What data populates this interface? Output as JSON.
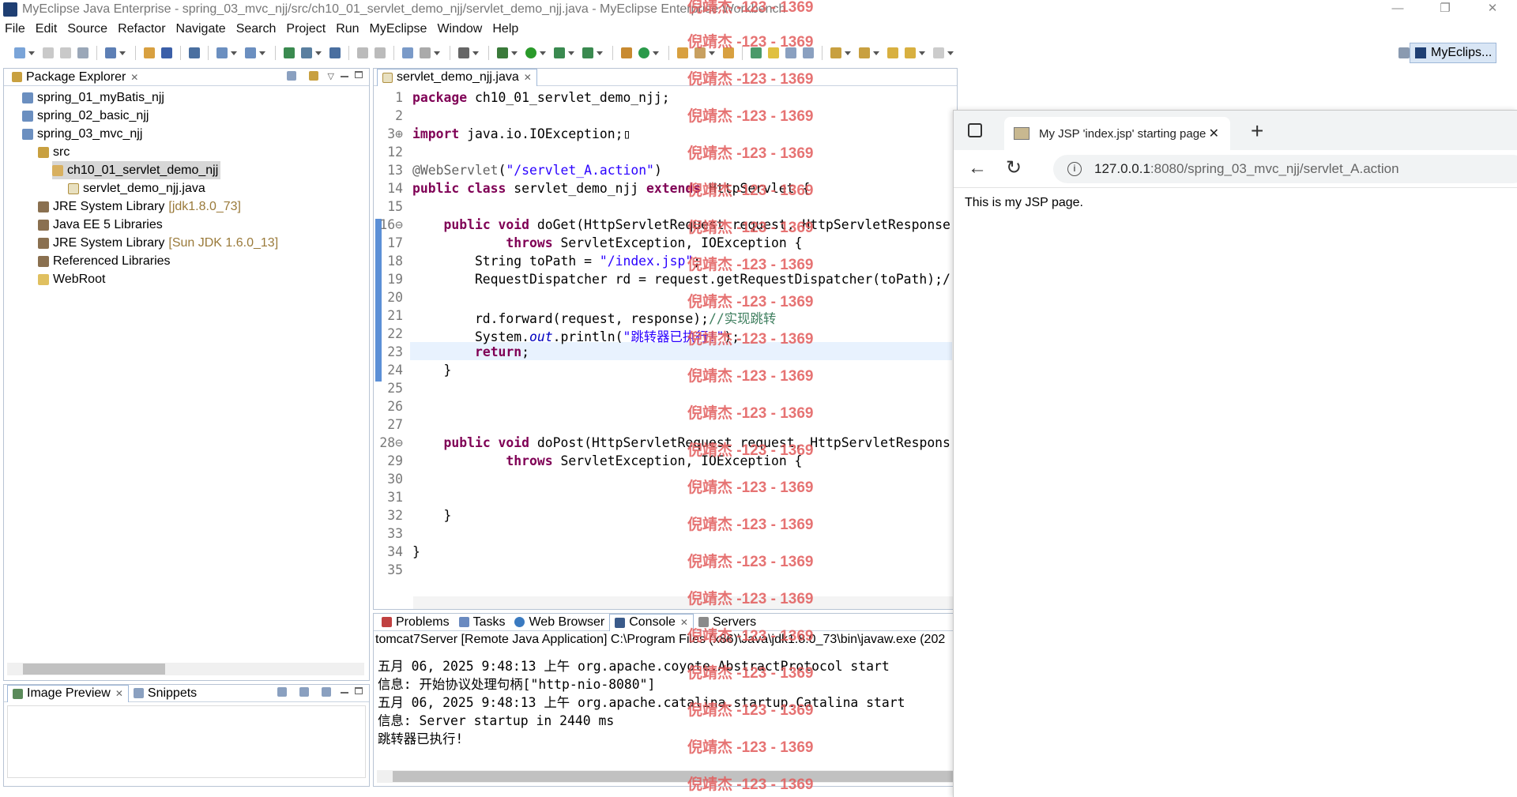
{
  "window": {
    "title": "MyEclipse Java Enterprise - spring_03_mvc_njj/src/ch10_01_servlet_demo_njj/servlet_demo_njj.java - MyEclipse Enterprise Workbench",
    "minimize": "—",
    "restore": "❐",
    "close": "✕"
  },
  "menu": [
    "File",
    "Edit",
    "Source",
    "Refactor",
    "Navigate",
    "Search",
    "Project",
    "Run",
    "MyEclipse",
    "Window",
    "Help"
  ],
  "perspective": "MyEclips...",
  "package_explorer": {
    "tab": "Package Explorer",
    "items": [
      {
        "label": "spring_01_myBatis_njj",
        "extra": ""
      },
      {
        "label": "spring_02_basic_njj",
        "extra": ""
      },
      {
        "label": "spring_03_mvc_njj",
        "extra": ""
      },
      {
        "label": "src",
        "extra": ""
      },
      {
        "label": "ch10_01_servlet_demo_njj",
        "extra": ""
      },
      {
        "label": "servlet_demo_njj.java",
        "extra": ""
      },
      {
        "label": "JRE System Library",
        "extra": "[jdk1.8.0_73]"
      },
      {
        "label": "Java EE 5 Libraries",
        "extra": ""
      },
      {
        "label": "JRE System Library",
        "extra": "[Sun JDK 1.6.0_13]"
      },
      {
        "label": "Referenced Libraries",
        "extra": ""
      },
      {
        "label": "WebRoot",
        "extra": ""
      }
    ]
  },
  "image_preview": {
    "tab": "Image Preview",
    "tab2": "Snippets"
  },
  "editor": {
    "tab": "servlet_demo_njj.java",
    "lines": [
      {
        "n": "1",
        "code": "package ch10_01_servlet_demo_njj;"
      },
      {
        "n": "2",
        "code": ""
      },
      {
        "n": "3⊕",
        "code": "import java.io.IOException;▯"
      },
      {
        "n": "12",
        "code": ""
      },
      {
        "n": "13",
        "code": "@WebServlet(\"/servlet_A.action\")"
      },
      {
        "n": "14",
        "code": "public class servlet_demo_njj extends HttpServlet {"
      },
      {
        "n": "15",
        "code": ""
      },
      {
        "n": "16⊖",
        "code": "    public void doGet(HttpServletRequest request, HttpServletResponse"
      },
      {
        "n": "17",
        "code": "            throws ServletException, IOException {"
      },
      {
        "n": "18",
        "code": "        String toPath = \"/index.jsp\";"
      },
      {
        "n": "19",
        "code": "        RequestDispatcher rd = request.getRequestDispatcher(toPath);/"
      },
      {
        "n": "20",
        "code": ""
      },
      {
        "n": "21",
        "code": "        rd.forward(request, response);//实现跳转"
      },
      {
        "n": "22",
        "code": "        System.out.println(\"跳转器已执行!\");"
      },
      {
        "n": "23",
        "code": "        return;"
      },
      {
        "n": "24",
        "code": "    }"
      },
      {
        "n": "25",
        "code": ""
      },
      {
        "n": "26",
        "code": ""
      },
      {
        "n": "27",
        "code": ""
      },
      {
        "n": "28⊖",
        "code": "    public void doPost(HttpServletRequest request, HttpServletRespons"
      },
      {
        "n": "29",
        "code": "            throws ServletException, IOException {"
      },
      {
        "n": "30",
        "code": ""
      },
      {
        "n": "31",
        "code": ""
      },
      {
        "n": "32",
        "code": "    }"
      },
      {
        "n": "33",
        "code": ""
      },
      {
        "n": "34",
        "code": "}"
      },
      {
        "n": "35",
        "code": ""
      }
    ]
  },
  "bottom": {
    "tabs": [
      "Problems",
      "Tasks",
      "Web Browser",
      "Console",
      "Servers"
    ],
    "console_header": "tomcat7Server [Remote Java Application] C:\\Program Files (x86)\\Java\\jdk1.8.0_73\\bin\\javaw.exe (202",
    "console_lines": [
      "五月 06, 2025 9:48:13 上午 org.apache.coyote.AbstractProtocol start",
      "信息: 开始协议处理句柄[\"http-nio-8080\"]",
      "五月 06, 2025 9:48:13 上午 org.apache.catalina.startup.Catalina start",
      "信息: Server startup in 2440 ms",
      "跳转器已执行!"
    ]
  },
  "browser": {
    "tab_title": "My JSP 'index.jsp' starting page",
    "url_host": "127.0.0.1",
    "url_rest": ":8080/spring_03_mvc_njj/servlet_A.action",
    "body_text": "This is my JSP page.",
    "close": "✕",
    "new_tab": "+"
  },
  "watermark": "倪靖杰 -123 - 1369"
}
